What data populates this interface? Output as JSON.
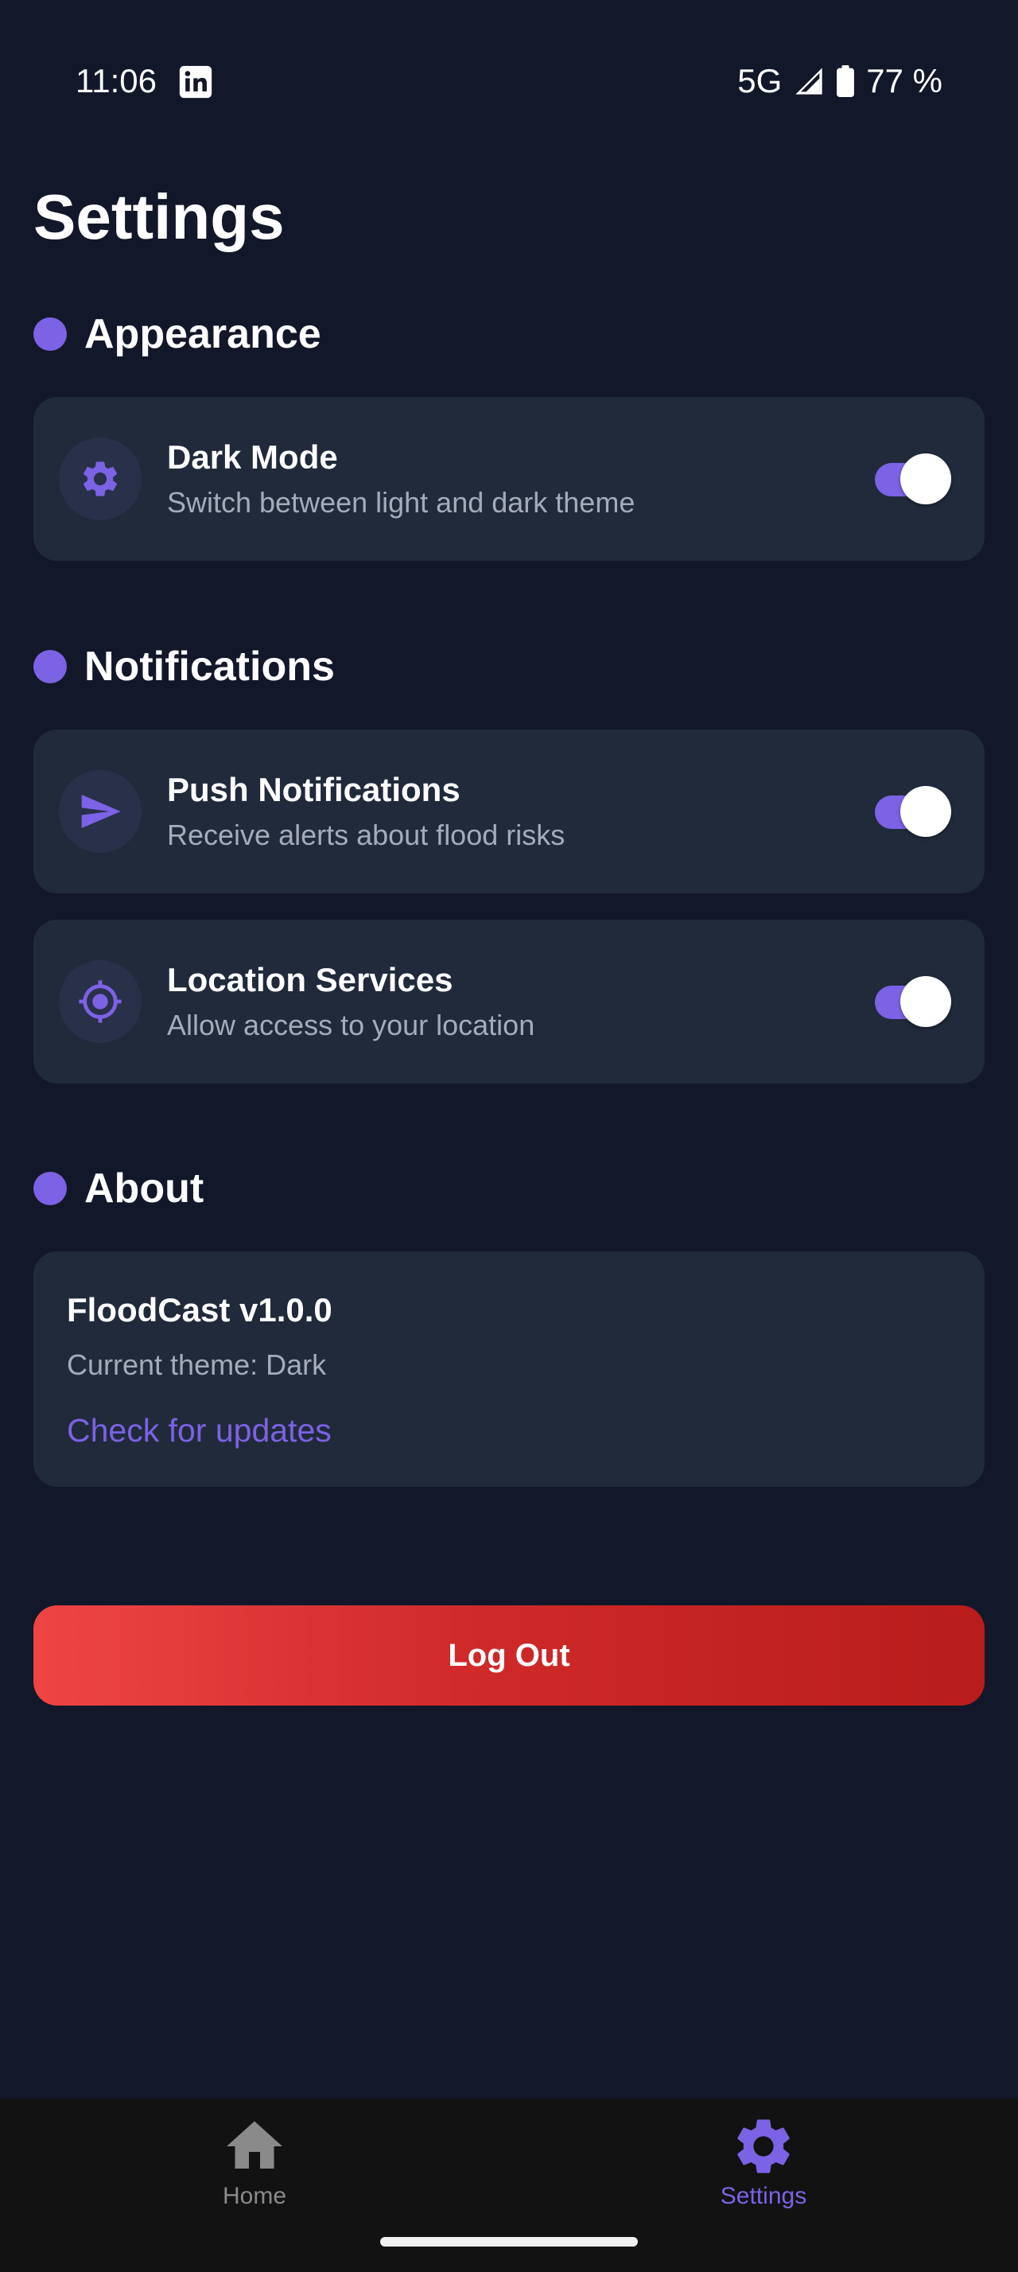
{
  "status_bar": {
    "time": "11:06",
    "network": "5G",
    "battery": "77 %",
    "app_icon": "linkedin-icon"
  },
  "page": {
    "title": "Settings"
  },
  "sections": {
    "appearance": {
      "title": "Appearance",
      "items": [
        {
          "title": "Dark Mode",
          "description": "Switch between light and dark theme",
          "icon": "gear-icon",
          "enabled": true
        }
      ]
    },
    "notifications": {
      "title": "Notifications",
      "items": [
        {
          "title": "Push Notifications",
          "description": "Receive alerts about flood risks",
          "icon": "send-icon",
          "enabled": true
        },
        {
          "title": "Location Services",
          "description": "Allow access to your location",
          "icon": "location-target-icon",
          "enabled": true
        }
      ]
    },
    "about": {
      "title": "About",
      "version": "FloodCast v1.0.0",
      "theme_text": "Current theme: Dark",
      "update_link": "Check for updates"
    }
  },
  "logout": {
    "label": "Log Out"
  },
  "bottom_nav": {
    "items": [
      {
        "label": "Home",
        "icon": "home-icon",
        "active": false
      },
      {
        "label": "Settings",
        "icon": "gear-icon",
        "active": true
      }
    ]
  },
  "colors": {
    "background": "#121829",
    "card": "#202a3b",
    "accent": "#7c62e4",
    "muted_text": "#a4acba",
    "logout_start": "#ee4444",
    "logout_end": "#b81c1c",
    "nav_background": "#121212",
    "nav_inactive": "#8a8a8a"
  }
}
